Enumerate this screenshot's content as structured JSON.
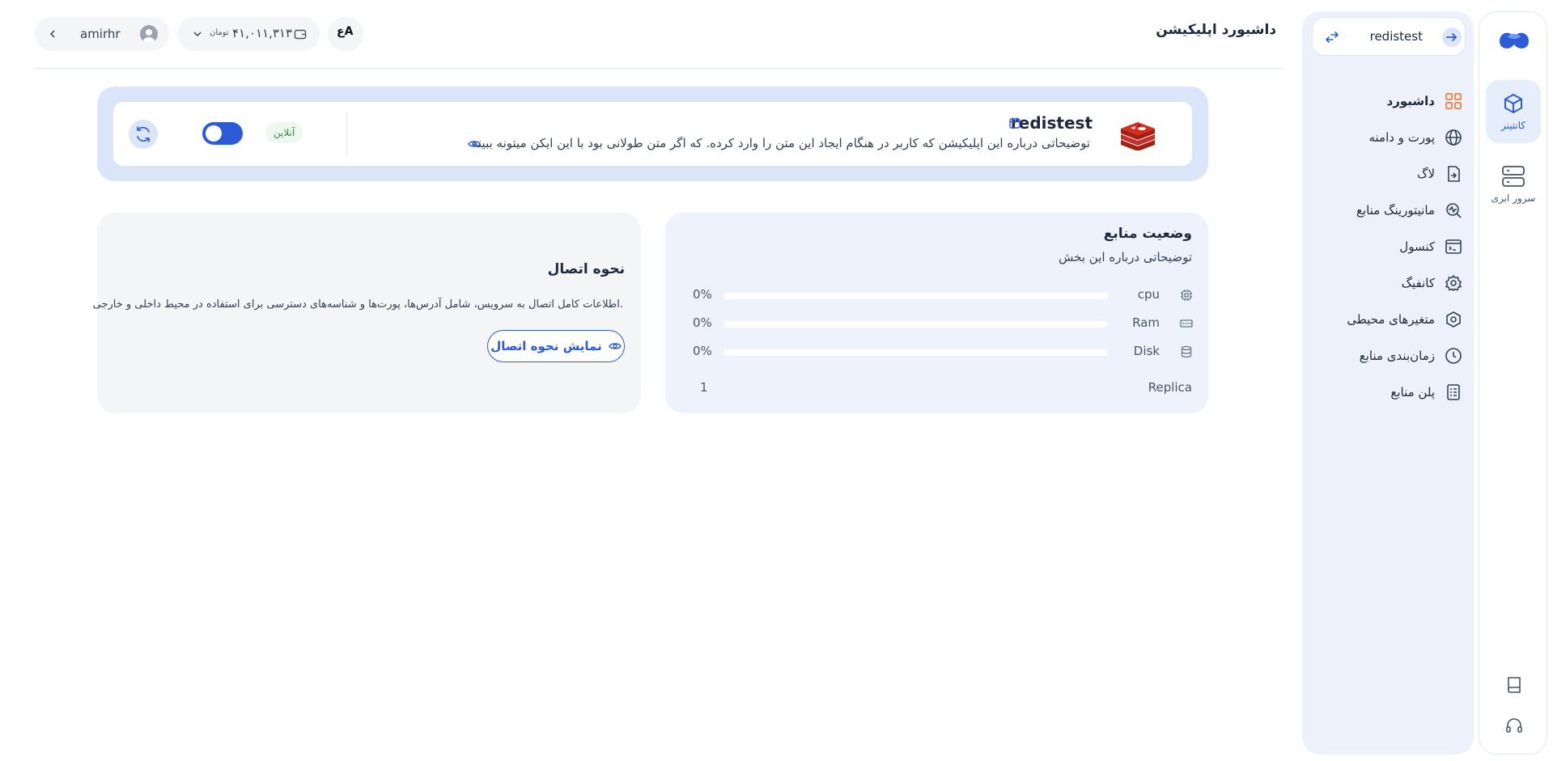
{
  "header": {
    "title": "داشبورد اپلیکیشن",
    "username": "amirhr",
    "wallet_amount": "۴۱,۰۱۱,۳۱۳",
    "wallet_currency": "تومان",
    "lang_label": "ع‌A"
  },
  "rail": {
    "items": [
      {
        "label": "کانتینر",
        "icon": "cube-icon",
        "active": true
      },
      {
        "label": "سرور ابری",
        "icon": "server-icon",
        "active": false
      }
    ]
  },
  "sidebar": {
    "app_selector": "redistest",
    "items": [
      {
        "label": "داشبورد",
        "icon": "dashboard-grid-icon",
        "active": true
      },
      {
        "label": "پورت و دامنه",
        "icon": "globe-icon"
      },
      {
        "label": "لاگ",
        "icon": "log-file-icon"
      },
      {
        "label": "مانیتورینگ منابع",
        "icon": "monitoring-icon"
      },
      {
        "label": "کنسول",
        "icon": "terminal-icon"
      },
      {
        "label": "کانفیگ",
        "icon": "gear-icon"
      },
      {
        "label": "متغیرهای محیطی",
        "icon": "hexagon-icon"
      },
      {
        "label": "زمان‌بندی منابع",
        "icon": "clock-icon"
      },
      {
        "label": "پلن منابع",
        "icon": "plan-list-icon"
      }
    ]
  },
  "app": {
    "name": "redistest",
    "description": "توضیحاتی درباره این اپلیکیشن که کاربر در هنگام ایجاد این متن را وارد کرده. که اگر متن طولانی بود با این ایکن میتونه ببینه",
    "status": "آنلاین",
    "enabled": true
  },
  "resources": {
    "title": "وضعیت منابع",
    "subtitle": "توضیحاتی درباره این بخش",
    "rows": [
      {
        "label": "cpu",
        "percent": "0%",
        "value": 0,
        "icon": "cpu-icon"
      },
      {
        "label": "Ram",
        "percent": "0%",
        "value": 0,
        "icon": "ram-icon"
      },
      {
        "label": "Disk",
        "percent": "0%",
        "value": 0,
        "icon": "disk-icon"
      }
    ],
    "replica_label": "Replica",
    "replica_value": "1"
  },
  "connection": {
    "title": "نحوه اتصال",
    "description": "اطلاعات کامل اتصال به سرویس، شامل آدرس‌ها، پورت‌ها و شناسه‌های دسترسی برای استفاده در محیط داخلی و خارجی.",
    "button_label": "نمایش نحوه اتصال"
  },
  "colors": {
    "accent": "#2b5bd7",
    "sidebar_bg": "#edf1fb",
    "online": "#2f8f3c"
  }
}
